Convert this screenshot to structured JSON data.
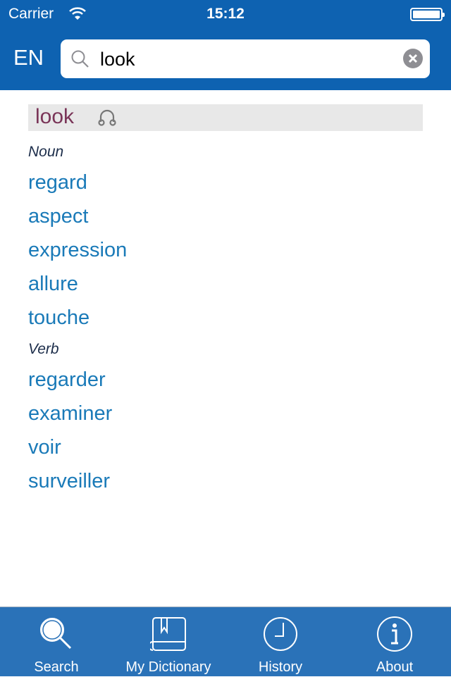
{
  "status": {
    "carrier": "Carrier",
    "time": "15:12"
  },
  "header": {
    "language": "EN",
    "search_value": "look",
    "search_placeholder": ""
  },
  "entry": {
    "headword": "look",
    "sections": [
      {
        "pos": "Noun",
        "translations": [
          "regard",
          "aspect",
          "expression",
          "allure",
          "touche"
        ]
      },
      {
        "pos": "Verb",
        "translations": [
          "regarder",
          "examiner",
          "voir",
          "surveiller"
        ]
      }
    ]
  },
  "tabs": [
    {
      "label": "Search",
      "icon": "search-icon",
      "selected": true
    },
    {
      "label": "My Dictionary",
      "icon": "book-icon"
    },
    {
      "label": "History",
      "icon": "clock-icon"
    },
    {
      "label": "About",
      "icon": "info-icon"
    }
  ],
  "colors": {
    "header": "#0e62b1",
    "tabbar": "#2a72b8",
    "link": "#1a7ab8",
    "headword": "#7a3558"
  }
}
